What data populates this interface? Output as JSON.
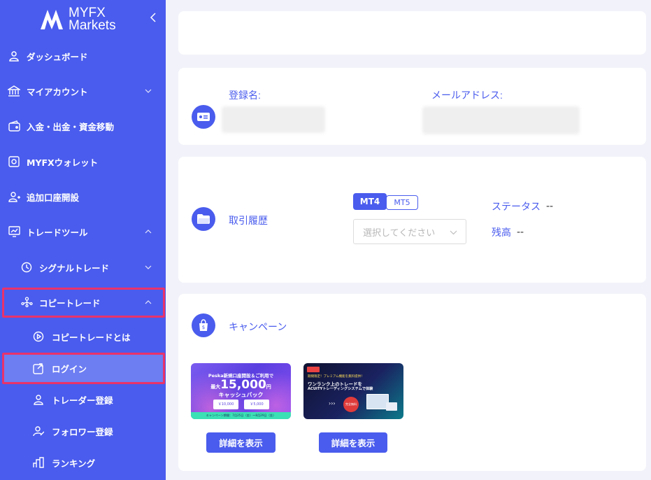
{
  "brand": {
    "name_line1": "MYFX",
    "name_line2": "Markets"
  },
  "sidebar": {
    "items": [
      {
        "label": "ダッシュボード",
        "icon": "user-icon"
      },
      {
        "label": "マイアカウント",
        "icon": "bank-icon"
      },
      {
        "label": "入金・出金・資金移動",
        "icon": "wallet-icon"
      },
      {
        "label": "MYFXウォレット",
        "icon": "safe-icon"
      },
      {
        "label": "追加口座開設",
        "icon": "user-add-icon"
      },
      {
        "label": "トレードツール",
        "icon": "chart-icon"
      },
      {
        "label": "シグナルトレード",
        "icon": "signal-icon"
      },
      {
        "label": "コピートレード",
        "icon": "network-icon"
      },
      {
        "label": "コピートレードとは",
        "icon": "play-icon"
      },
      {
        "label": "ログイン",
        "icon": "login-icon"
      },
      {
        "label": "トレーダー登録",
        "icon": "trader-icon"
      },
      {
        "label": "フォロワー登録",
        "icon": "follower-icon"
      },
      {
        "label": "ランキング",
        "icon": "ranking-icon"
      }
    ]
  },
  "profile": {
    "name_label": "登録名:",
    "email_label": "メールアドレス:"
  },
  "trading": {
    "title": "取引履歴",
    "platform_tabs": [
      "MT4",
      "MT5"
    ],
    "active_platform": "MT4",
    "select_placeholder": "選択してください",
    "status_label": "ステータス",
    "status_value": "--",
    "balance_label": "残高",
    "balance_value": "--"
  },
  "campaign": {
    "title": "キャンペーン",
    "banners": [
      {
        "headline1": "Peska新規口座開設＆ご利用で",
        "amount": "15,000",
        "amount_prefix": "最大",
        "amount_unit": "円",
        "headline2": "キャッシュバック",
        "sub1": "￥10,000",
        "sub2": "￥5,000",
        "period": "キャンペーン期間：7月25日（金）～8月29日（金）",
        "button": "詳細を表示"
      },
      {
        "headline1": "期間限定！プレミアム機能を無料提供！",
        "headline2": "ワンランク上のトレードを",
        "headline3": "ACUITYトレーディングシステムで体験",
        "badge": "完全無料",
        "button": "詳細を表示"
      }
    ]
  },
  "colors": {
    "primary": "#4a5ced",
    "highlight": "#e8336b",
    "page_bg": "#f2f3fa"
  }
}
